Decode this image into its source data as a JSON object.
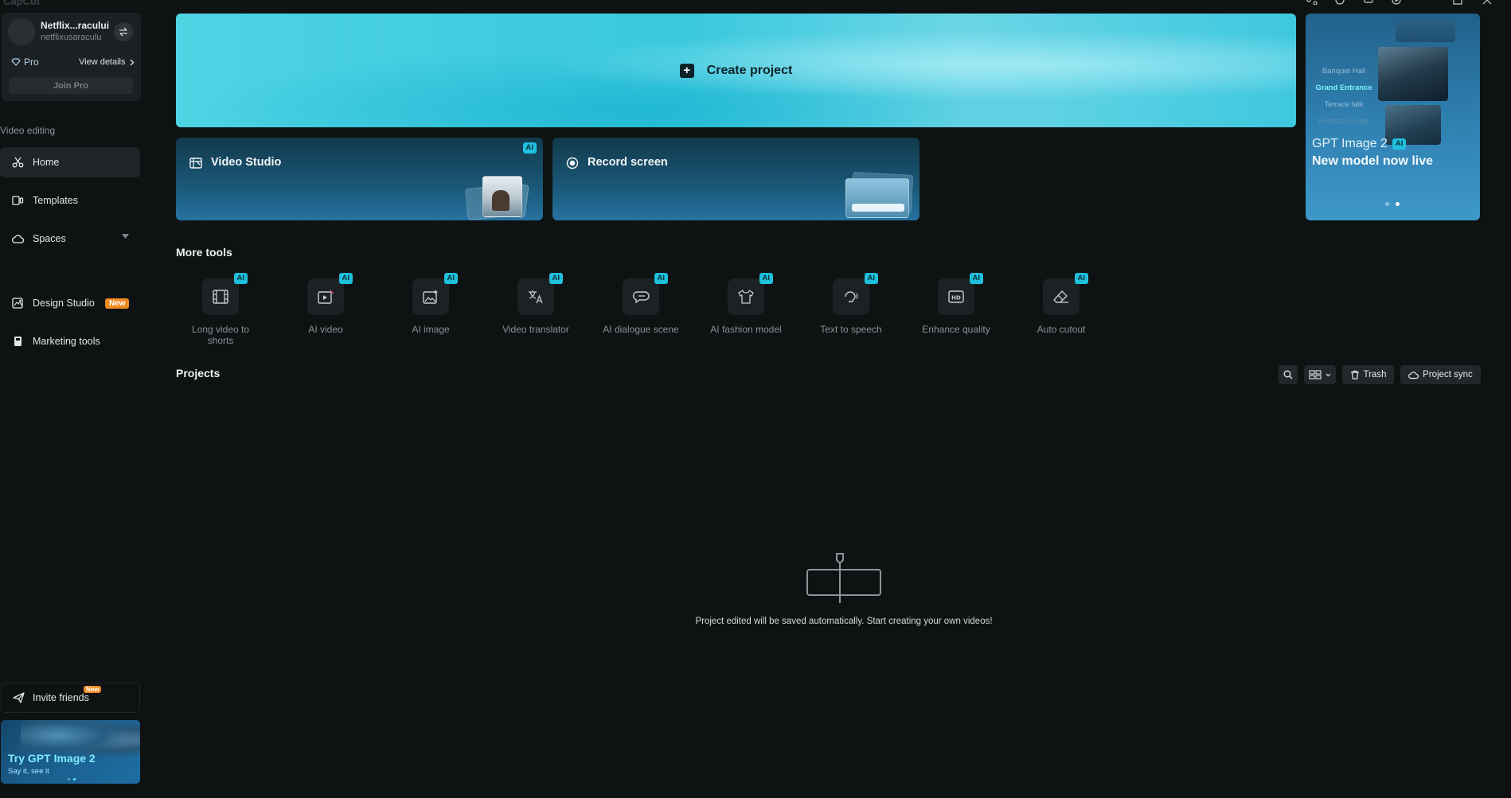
{
  "app": {
    "brand": "CapCut"
  },
  "account": {
    "name": "Netflix...racului",
    "handle": "netflixusaraculu",
    "plan": "Pro",
    "view_details": "View details",
    "join_pro": "Join Pro"
  },
  "sidebar": {
    "section_label": "Video editing",
    "items": [
      {
        "label": "Home",
        "icon": "home-icon",
        "active": true
      },
      {
        "label": "Templates",
        "icon": "templates-icon"
      },
      {
        "label": "Spaces",
        "icon": "cloud-icon"
      },
      {
        "label": "Design Studio",
        "icon": "design-icon",
        "badge": "New"
      },
      {
        "label": "Marketing tools",
        "icon": "marketing-icon"
      }
    ],
    "invite": {
      "label": "Invite friends",
      "badge": "New"
    },
    "promo": {
      "title": "Try GPT Image 2",
      "subtitle": "Say it, see it"
    }
  },
  "main": {
    "create_project": "Create project",
    "video_studio": {
      "label": "Video Studio",
      "badge": "AI"
    },
    "record_screen": {
      "label": "Record screen"
    },
    "hero": {
      "menu": [
        "Banquet Hall",
        "Grand Entrance",
        "Terrace talk",
        "Rooftop lounge"
      ],
      "title": "GPT Image 2",
      "badge": "AI",
      "subtitle": "New model now live"
    },
    "more_tools_label": "More tools",
    "tools": [
      {
        "label": "Long video to shorts",
        "badge": "AI",
        "icon": "film-strip-icon"
      },
      {
        "label": "AI video",
        "badge": "AI",
        "icon": "ai-video-icon"
      },
      {
        "label": "AI image",
        "badge": "AI",
        "icon": "ai-image-icon"
      },
      {
        "label": "Video translator",
        "badge": "AI",
        "icon": "translate-icon"
      },
      {
        "label": "AI dialogue scene",
        "badge": "AI",
        "icon": "dialogue-icon"
      },
      {
        "label": "AI fashion model",
        "badge": "AI",
        "icon": "shirt-icon"
      },
      {
        "label": "Text to speech",
        "badge": "AI",
        "icon": "speech-icon"
      },
      {
        "label": "Enhance quality",
        "badge": "AI",
        "icon": "hd-icon"
      },
      {
        "label": "Auto cutout",
        "badge": "AI",
        "icon": "eraser-icon"
      }
    ],
    "projects_label": "Projects",
    "trash_label": "Trash",
    "project_sync_label": "Project sync",
    "empty_message": "Project edited will be saved automatically. Start creating your own videos!"
  },
  "colors": {
    "accent": "#1ec0dd",
    "badge_new": "#f08a1f",
    "background": "#0f1213"
  }
}
